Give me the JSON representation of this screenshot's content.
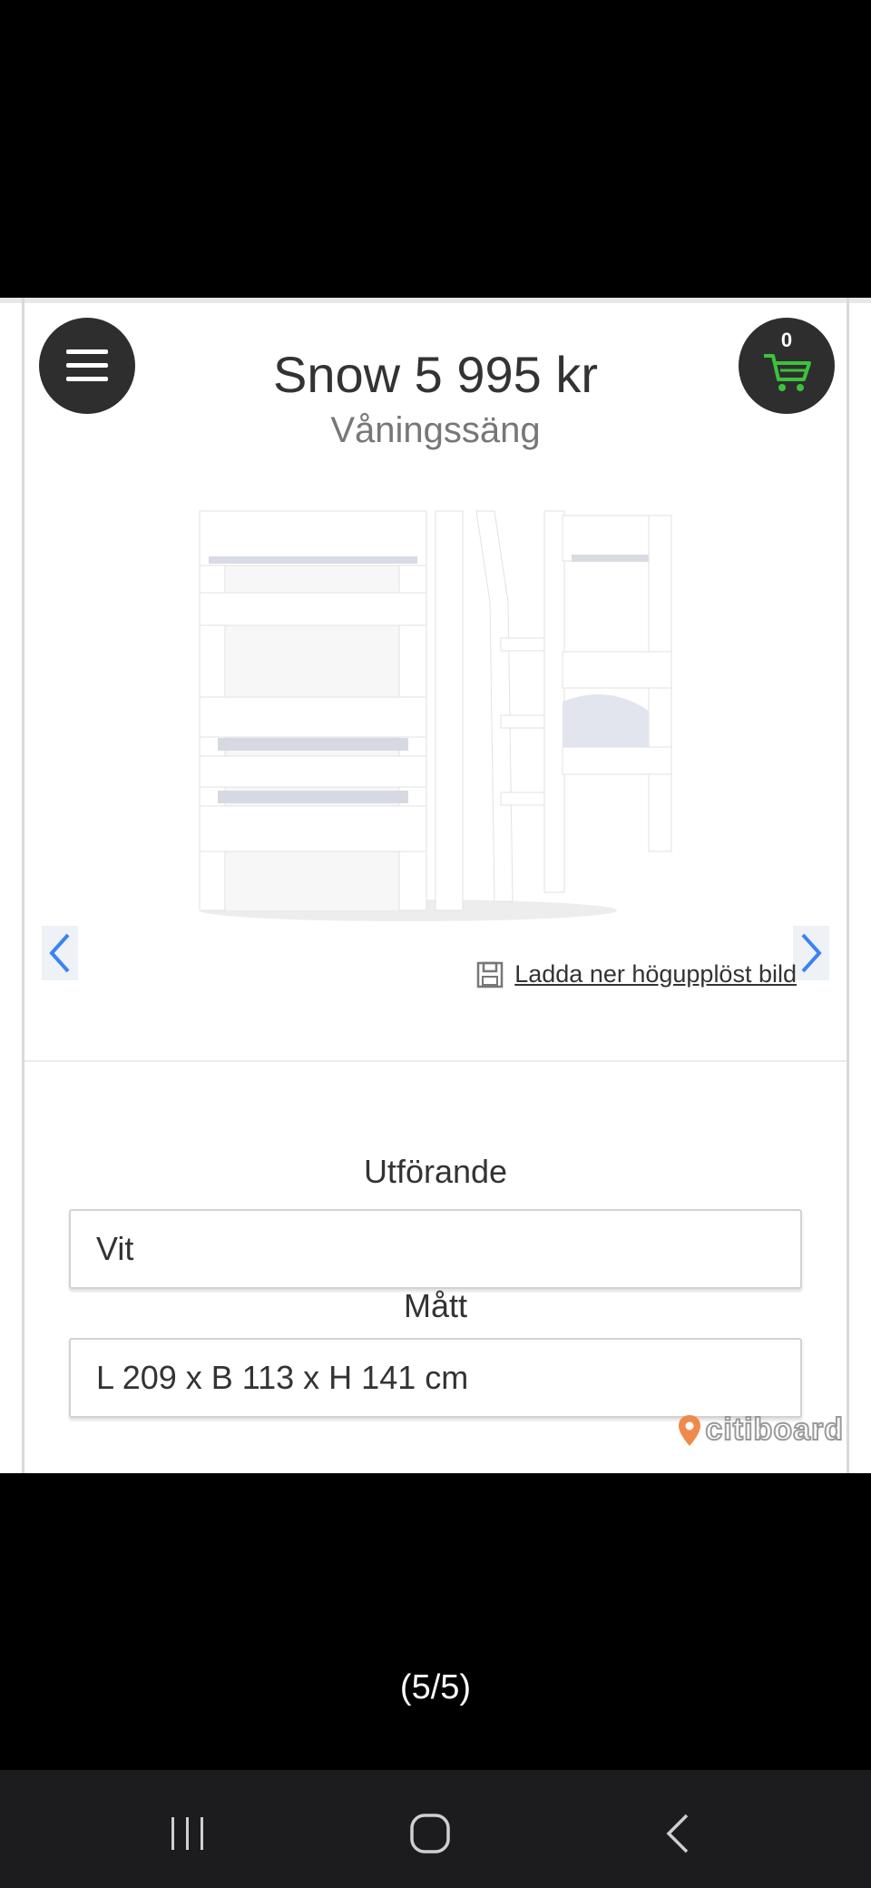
{
  "product": {
    "title": "Snow 5 995 kr",
    "subtitle": "Våningssäng"
  },
  "cart": {
    "count": "0"
  },
  "download": {
    "label": "Ladda ner högupplöst bild"
  },
  "options": [
    {
      "label": "Utförande",
      "value": "Vit"
    },
    {
      "label": "Mått",
      "value": "L 209 x B 113 x H 141 cm"
    }
  ],
  "watermark": {
    "text": "citiboard",
    "pin_color": "#f08a4b"
  },
  "viewer": {
    "counter": "(5/5)"
  },
  "colors": {
    "accent_green": "#3cc23c",
    "nav_blue": "#3b82f6",
    "button_dark": "#2e2e2e"
  },
  "icons": {
    "menu": "hamburger-icon",
    "cart": "shopping-cart-icon",
    "prev": "chevron-left-icon",
    "next": "chevron-right-icon",
    "save": "floppy-disk-icon",
    "recents": "recents-icon",
    "home": "home-icon",
    "back": "back-icon"
  }
}
